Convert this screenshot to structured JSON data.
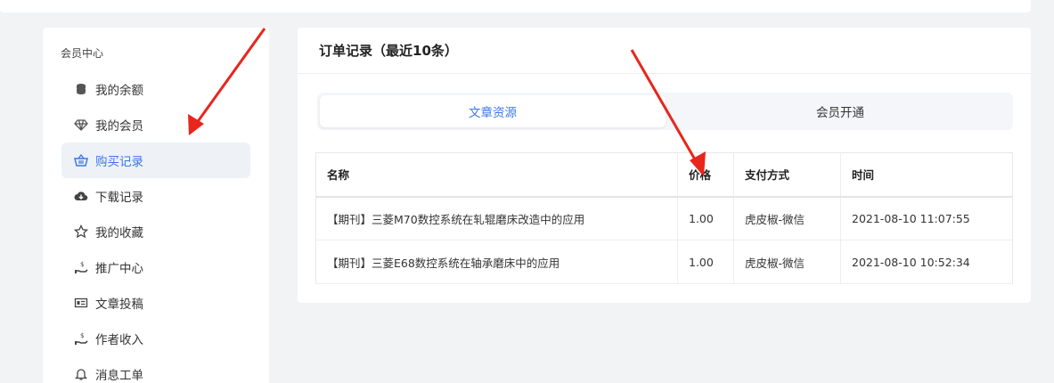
{
  "sidebar": {
    "title": "会员中心",
    "items": [
      {
        "label": "我的余额",
        "icon": "coins-icon",
        "active": false
      },
      {
        "label": "我的会员",
        "icon": "diamond-icon",
        "active": false
      },
      {
        "label": "购买记录",
        "icon": "basket-icon",
        "active": true
      },
      {
        "label": "下载记录",
        "icon": "cloud-download-icon",
        "active": false
      },
      {
        "label": "我的收藏",
        "icon": "star-icon",
        "active": false
      },
      {
        "label": "推广中心",
        "icon": "hand-coin-icon",
        "active": false
      },
      {
        "label": "文章投稿",
        "icon": "id-card-icon",
        "active": false
      },
      {
        "label": "作者收入",
        "icon": "hand-dollar-icon",
        "active": false
      },
      {
        "label": "消息工单",
        "icon": "bell-icon",
        "active": false
      }
    ]
  },
  "main": {
    "title": "订单记录（最近10条）",
    "tabs": [
      {
        "label": "文章资源",
        "active": true
      },
      {
        "label": "会员开通",
        "active": false
      }
    ],
    "table": {
      "headers": [
        "名称",
        "价格",
        "支付方式",
        "时间"
      ],
      "rows": [
        [
          "【期刊】三菱M70数控系统在轧辊磨床改造中的应用",
          "1.00",
          "虎皮椒-微信",
          "2021-08-10 11:07:55"
        ],
        [
          "【期刊】三菱E68数控系统在轴承磨床中的应用",
          "1.00",
          "虎皮椒-微信",
          "2021-08-10 10:52:34"
        ]
      ]
    }
  },
  "colors": {
    "accent": "#3b78e7",
    "arrow": "#e8261c"
  }
}
